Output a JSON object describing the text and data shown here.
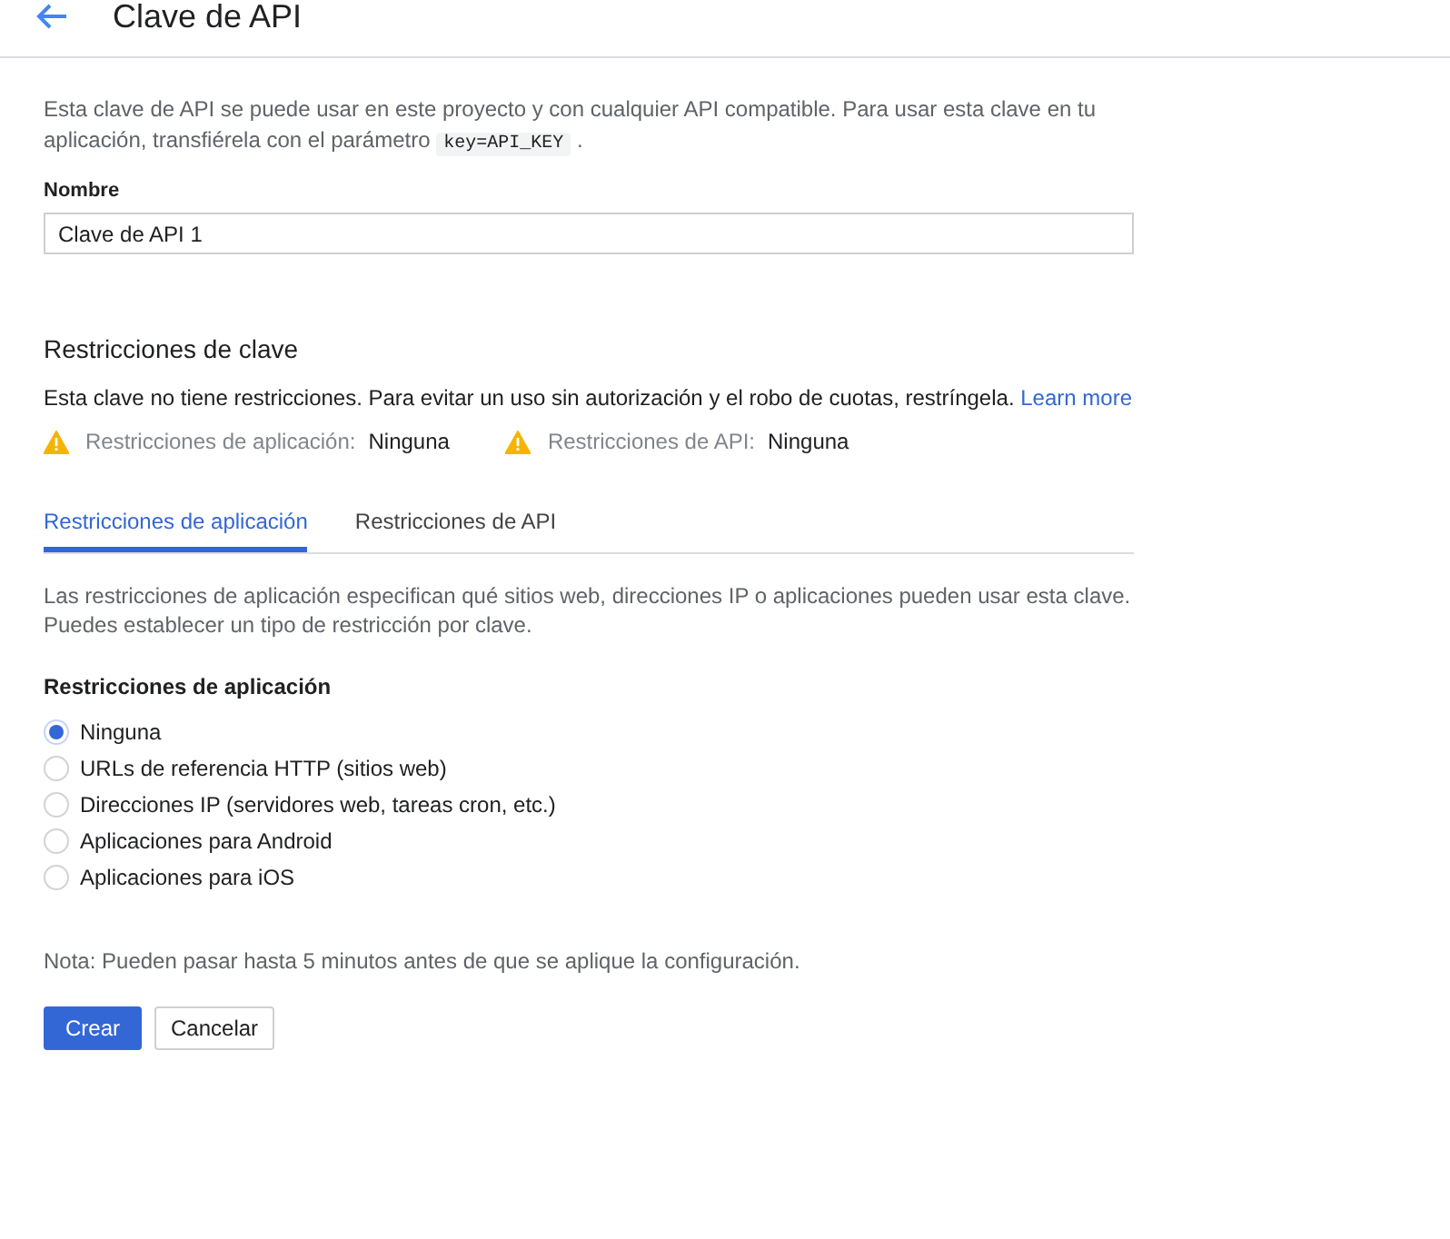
{
  "header": {
    "title": "Clave de API"
  },
  "intro": {
    "text": "Esta clave de API se puede usar en este proyecto y con cualquier API compatible. Para usar esta clave en tu aplicación, transfiérela con el parámetro",
    "code": "key=API_KEY",
    "suffix": "."
  },
  "name_field": {
    "label": "Nombre",
    "value": "Clave de API 1"
  },
  "key_restrictions": {
    "title": "Restricciones de clave",
    "text": "Esta clave no tiene restricciones. Para evitar un uso sin autorización y el robo de cuotas, restríngela.",
    "link": "Learn more",
    "warnings": [
      {
        "label": "Restricciones de aplicación:",
        "value": "Ninguna"
      },
      {
        "label": "Restricciones de API:",
        "value": "Ninguna"
      }
    ]
  },
  "tabs": [
    {
      "label": "Restricciones de aplicación",
      "selected": true
    },
    {
      "label": "Restricciones de API",
      "selected": false
    }
  ],
  "tab_description": "Las restricciones de aplicación especifican qué sitios web, direcciones IP o aplicaciones pueden usar esta clave. Puedes establecer un tipo de restricción por clave.",
  "app_restrictions": {
    "title": "Restricciones de aplicación",
    "options": [
      {
        "label": "Ninguna",
        "selected": true
      },
      {
        "label": "URLs de referencia HTTP (sitios web)",
        "selected": false
      },
      {
        "label": "Direcciones IP (servidores web, tareas cron, etc.)",
        "selected": false
      },
      {
        "label": "Aplicaciones para Android",
        "selected": false
      },
      {
        "label": "Aplicaciones para iOS",
        "selected": false
      }
    ]
  },
  "note": "Nota: Pueden pasar hasta 5 minutos antes de que se aplique la configuración.",
  "buttons": [
    {
      "label": "Crear",
      "kind": "primary"
    },
    {
      "label": "Cancelar",
      "kind": "secondary"
    }
  ]
}
